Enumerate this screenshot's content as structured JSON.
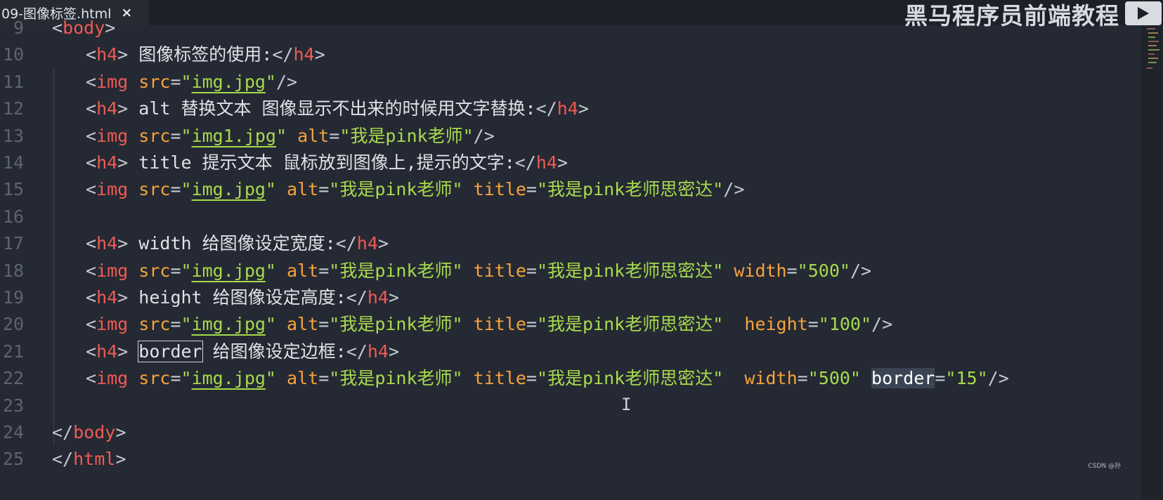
{
  "tab": {
    "title": "09-图像标签.html",
    "close_glyph": "×"
  },
  "watermark": {
    "text": "黑马程序员前端教程"
  },
  "credit": "CSDN @孙",
  "colors": {
    "background": "#252933",
    "tag": "#f05a55",
    "attribute": "#f6a33c",
    "string": "#a6db4d",
    "punctuation": "#c5c9d2",
    "line_number": "#5d6370"
  },
  "lines": [
    {
      "n": "9",
      "indent": 1,
      "tokens": [
        {
          "t": "<",
          "c": "punct"
        },
        {
          "t": "body",
          "c": "tag"
        },
        {
          "t": ">",
          "c": "punct"
        }
      ]
    },
    {
      "n": "10",
      "indent": 2,
      "tokens": [
        {
          "t": "<",
          "c": "punct"
        },
        {
          "t": "h4",
          "c": "tag"
        },
        {
          "t": ">",
          "c": "punct"
        },
        {
          "t": " 图像标签的使用:",
          "c": "text"
        },
        {
          "t": "</",
          "c": "punct"
        },
        {
          "t": "h4",
          "c": "tag"
        },
        {
          "t": ">",
          "c": "punct"
        }
      ]
    },
    {
      "n": "11",
      "indent": 2,
      "tokens": [
        {
          "t": "<",
          "c": "punct"
        },
        {
          "t": "img",
          "c": "tag"
        },
        {
          "t": " ",
          "c": "text"
        },
        {
          "t": "src",
          "c": "attr"
        },
        {
          "t": "=",
          "c": "punct"
        },
        {
          "t": "\"",
          "c": "str"
        },
        {
          "t": "img.jpg",
          "c": "str link"
        },
        {
          "t": "\"",
          "c": "str"
        },
        {
          "t": "/>",
          "c": "punct"
        }
      ]
    },
    {
      "n": "12",
      "indent": 2,
      "tokens": [
        {
          "t": "<",
          "c": "punct"
        },
        {
          "t": "h4",
          "c": "tag"
        },
        {
          "t": ">",
          "c": "punct"
        },
        {
          "t": " alt 替换文本 图像显示不出来的时候用文字替换:",
          "c": "text"
        },
        {
          "t": "</",
          "c": "punct"
        },
        {
          "t": "h4",
          "c": "tag"
        },
        {
          "t": ">",
          "c": "punct"
        }
      ]
    },
    {
      "n": "13",
      "indent": 2,
      "tokens": [
        {
          "t": "<",
          "c": "punct"
        },
        {
          "t": "img",
          "c": "tag"
        },
        {
          "t": " ",
          "c": "text"
        },
        {
          "t": "src",
          "c": "attr"
        },
        {
          "t": "=",
          "c": "punct"
        },
        {
          "t": "\"",
          "c": "str"
        },
        {
          "t": "img1.jpg",
          "c": "str link"
        },
        {
          "t": "\"",
          "c": "str"
        },
        {
          "t": " ",
          "c": "text"
        },
        {
          "t": "alt",
          "c": "attr"
        },
        {
          "t": "=",
          "c": "punct"
        },
        {
          "t": "\"我是pink老师\"",
          "c": "str"
        },
        {
          "t": "/>",
          "c": "punct"
        }
      ]
    },
    {
      "n": "14",
      "indent": 2,
      "tokens": [
        {
          "t": "<",
          "c": "punct"
        },
        {
          "t": "h4",
          "c": "tag"
        },
        {
          "t": ">",
          "c": "punct"
        },
        {
          "t": " title 提示文本 鼠标放到图像上,提示的文字:",
          "c": "text"
        },
        {
          "t": "</",
          "c": "punct"
        },
        {
          "t": "h4",
          "c": "tag"
        },
        {
          "t": ">",
          "c": "punct"
        }
      ]
    },
    {
      "n": "15",
      "indent": 2,
      "tokens": [
        {
          "t": "<",
          "c": "punct"
        },
        {
          "t": "img",
          "c": "tag"
        },
        {
          "t": " ",
          "c": "text"
        },
        {
          "t": "src",
          "c": "attr"
        },
        {
          "t": "=",
          "c": "punct"
        },
        {
          "t": "\"",
          "c": "str"
        },
        {
          "t": "img.jpg",
          "c": "str link"
        },
        {
          "t": "\"",
          "c": "str"
        },
        {
          "t": " ",
          "c": "text"
        },
        {
          "t": "alt",
          "c": "attr"
        },
        {
          "t": "=",
          "c": "punct"
        },
        {
          "t": "\"我是pink老师\"",
          "c": "str"
        },
        {
          "t": " ",
          "c": "text"
        },
        {
          "t": "title",
          "c": "attr"
        },
        {
          "t": "=",
          "c": "punct"
        },
        {
          "t": "\"我是pink老师思密达\"",
          "c": "str"
        },
        {
          "t": "/>",
          "c": "punct"
        }
      ]
    },
    {
      "n": "16",
      "indent": 0,
      "tokens": []
    },
    {
      "n": "17",
      "indent": 2,
      "tokens": [
        {
          "t": "<",
          "c": "punct"
        },
        {
          "t": "h4",
          "c": "tag"
        },
        {
          "t": ">",
          "c": "punct"
        },
        {
          "t": " width 给图像设定宽度:",
          "c": "text"
        },
        {
          "t": "</",
          "c": "punct"
        },
        {
          "t": "h4",
          "c": "tag"
        },
        {
          "t": ">",
          "c": "punct"
        }
      ]
    },
    {
      "n": "18",
      "indent": 2,
      "tokens": [
        {
          "t": "<",
          "c": "punct"
        },
        {
          "t": "img",
          "c": "tag"
        },
        {
          "t": " ",
          "c": "text"
        },
        {
          "t": "src",
          "c": "attr"
        },
        {
          "t": "=",
          "c": "punct"
        },
        {
          "t": "\"",
          "c": "str"
        },
        {
          "t": "img.jpg",
          "c": "str link"
        },
        {
          "t": "\"",
          "c": "str"
        },
        {
          "t": " ",
          "c": "text"
        },
        {
          "t": "alt",
          "c": "attr"
        },
        {
          "t": "=",
          "c": "punct"
        },
        {
          "t": "\"我是pink老师\"",
          "c": "str"
        },
        {
          "t": " ",
          "c": "text"
        },
        {
          "t": "title",
          "c": "attr"
        },
        {
          "t": "=",
          "c": "punct"
        },
        {
          "t": "\"我是pink老师思密达\"",
          "c": "str"
        },
        {
          "t": " ",
          "c": "text"
        },
        {
          "t": "width",
          "c": "attr"
        },
        {
          "t": "=",
          "c": "punct"
        },
        {
          "t": "\"500\"",
          "c": "str"
        },
        {
          "t": "/>",
          "c": "punct"
        }
      ]
    },
    {
      "n": "19",
      "indent": 2,
      "tokens": [
        {
          "t": "<",
          "c": "punct"
        },
        {
          "t": "h4",
          "c": "tag"
        },
        {
          "t": ">",
          "c": "punct"
        },
        {
          "t": " height 给图像设定高度:",
          "c": "text"
        },
        {
          "t": "</",
          "c": "punct"
        },
        {
          "t": "h4",
          "c": "tag"
        },
        {
          "t": ">",
          "c": "punct"
        }
      ]
    },
    {
      "n": "20",
      "indent": 2,
      "tokens": [
        {
          "t": "<",
          "c": "punct"
        },
        {
          "t": "img",
          "c": "tag"
        },
        {
          "t": " ",
          "c": "text"
        },
        {
          "t": "src",
          "c": "attr"
        },
        {
          "t": "=",
          "c": "punct"
        },
        {
          "t": "\"",
          "c": "str"
        },
        {
          "t": "img.jpg",
          "c": "str link"
        },
        {
          "t": "\"",
          "c": "str"
        },
        {
          "t": " ",
          "c": "text"
        },
        {
          "t": "alt",
          "c": "attr"
        },
        {
          "t": "=",
          "c": "punct"
        },
        {
          "t": "\"我是pink老师\"",
          "c": "str"
        },
        {
          "t": " ",
          "c": "text"
        },
        {
          "t": "title",
          "c": "attr"
        },
        {
          "t": "=",
          "c": "punct"
        },
        {
          "t": "\"我是pink老师思密达\"",
          "c": "str"
        },
        {
          "t": "  ",
          "c": "text"
        },
        {
          "t": "height",
          "c": "attr"
        },
        {
          "t": "=",
          "c": "punct"
        },
        {
          "t": "\"100\"",
          "c": "str"
        },
        {
          "t": "/>",
          "c": "punct"
        }
      ]
    },
    {
      "n": "21",
      "indent": 2,
      "tokens": [
        {
          "t": "<",
          "c": "punct"
        },
        {
          "t": "h4",
          "c": "tag"
        },
        {
          "t": ">",
          "c": "punct"
        },
        {
          "t": " ",
          "c": "text"
        },
        {
          "t": "border",
          "c": "text boxed"
        },
        {
          "t": " 给图像设定边框:",
          "c": "text"
        },
        {
          "t": "</",
          "c": "punct"
        },
        {
          "t": "h4",
          "c": "tag"
        },
        {
          "t": ">",
          "c": "punct"
        }
      ]
    },
    {
      "n": "22",
      "indent": 2,
      "tokens": [
        {
          "t": "<",
          "c": "punct"
        },
        {
          "t": "img",
          "c": "tag"
        },
        {
          "t": " ",
          "c": "text"
        },
        {
          "t": "src",
          "c": "attr"
        },
        {
          "t": "=",
          "c": "punct"
        },
        {
          "t": "\"",
          "c": "str"
        },
        {
          "t": "img.jpg",
          "c": "str link"
        },
        {
          "t": "\"",
          "c": "str"
        },
        {
          "t": " ",
          "c": "text"
        },
        {
          "t": "alt",
          "c": "attr"
        },
        {
          "t": "=",
          "c": "punct"
        },
        {
          "t": "\"我是pink老师\"",
          "c": "str"
        },
        {
          "t": " ",
          "c": "text"
        },
        {
          "t": "title",
          "c": "attr"
        },
        {
          "t": "=",
          "c": "punct"
        },
        {
          "t": "\"我是pink老师思密达\"",
          "c": "str"
        },
        {
          "t": "  ",
          "c": "text"
        },
        {
          "t": "width",
          "c": "attr"
        },
        {
          "t": "=",
          "c": "punct"
        },
        {
          "t": "\"500\"",
          "c": "str"
        },
        {
          "t": " ",
          "c": "text"
        },
        {
          "t": "border",
          "c": "attr sel"
        },
        {
          "t": "=",
          "c": "punct"
        },
        {
          "t": "\"15\"",
          "c": "str"
        },
        {
          "t": "/>",
          "c": "punct"
        }
      ]
    },
    {
      "n": "23",
      "indent": 0,
      "tokens": []
    },
    {
      "n": "24",
      "indent": 1,
      "tokens": [
        {
          "t": "</",
          "c": "punct"
        },
        {
          "t": "body",
          "c": "tag"
        },
        {
          "t": ">",
          "c": "punct"
        }
      ]
    },
    {
      "n": "25",
      "indent": 1,
      "tokens": [
        {
          "t": "</",
          "c": "punct"
        },
        {
          "t": "html",
          "c": "tag"
        },
        {
          "t": ">",
          "c": "punct"
        }
      ]
    }
  ]
}
